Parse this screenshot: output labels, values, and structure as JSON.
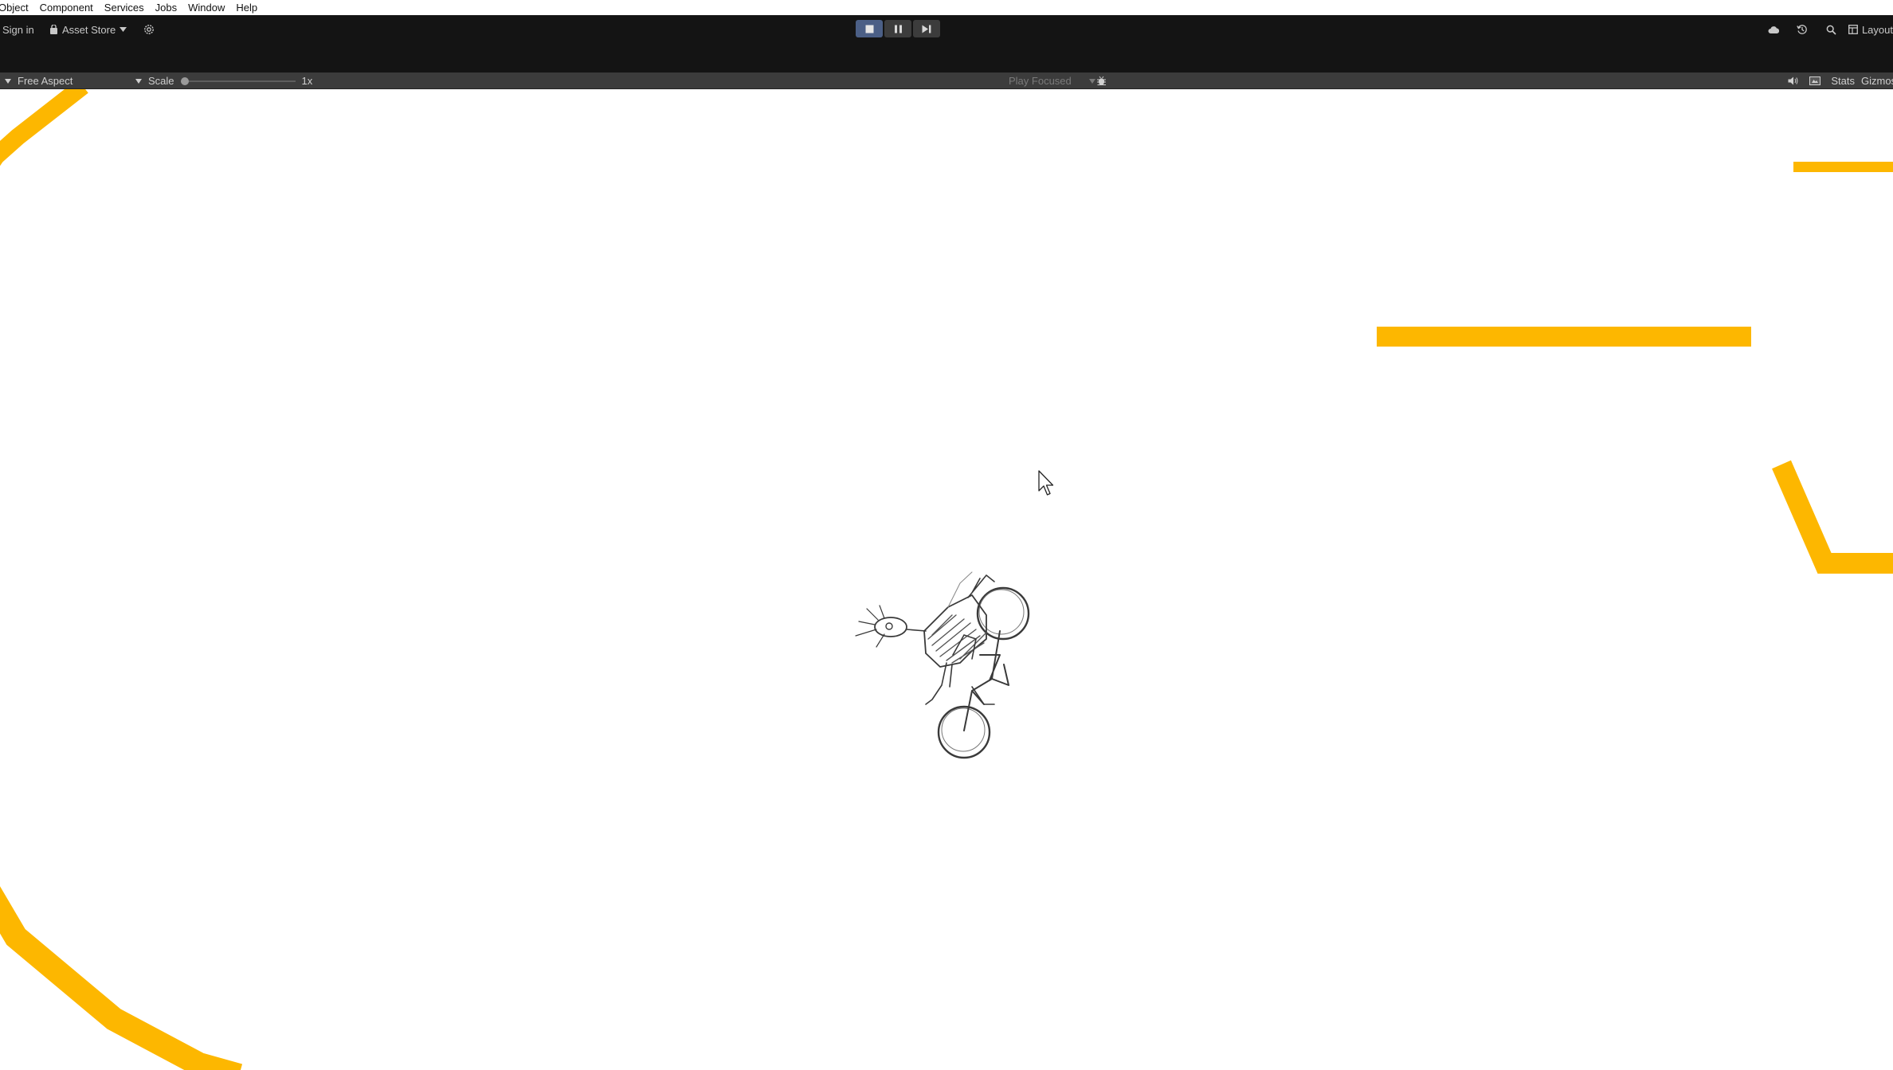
{
  "menubar": {
    "items": [
      "Object",
      "Component",
      "Services",
      "Jobs",
      "Window",
      "Help"
    ]
  },
  "toolbar": {
    "sign_in": "Sign in",
    "asset_store": "Asset Store",
    "icons": {
      "settings": "gear-icon",
      "play_controls": [
        "stop-icon",
        "pause-icon",
        "step-icon"
      ],
      "right": [
        "cloud-icon",
        "history-icon",
        "search-icon",
        "layout-icon"
      ]
    },
    "layout": "Layout"
  },
  "gameview": {
    "aspect": "Free Aspect",
    "scale_label": "Scale",
    "scale_value": "1x",
    "play_mode": "Play Focused",
    "stats": "Stats",
    "gizmos": "Gizmos"
  },
  "scene": {
    "track_color": "#FDB700",
    "background_color": "#FFFFFF",
    "player": "sketch-rider-on-motorbike"
  },
  "colors": {
    "toolbar_bg": "#141414",
    "gamebar_bg": "#3C3C3C",
    "play_active": "#4B5F86"
  }
}
